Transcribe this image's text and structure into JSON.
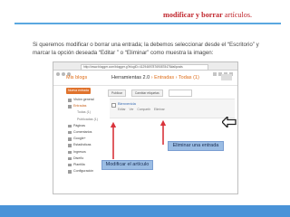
{
  "slide": {
    "title_bold": "modificar y borrar",
    "title_rest": "artículos.",
    "intro": "Si queremos modificar o borrar una entrada; la debemos seleccionar desde el “Escritorio” y marcar la opción deseada “Editar ” o “Eliminar” como muestra la imagen:",
    "colors": {
      "accent_rule": "#5aa8e0",
      "title": "#c0262d",
      "bottom_bar": "#4a93d8",
      "arrow": "#d9333b"
    }
  },
  "browser": {
    "url": "http://www.blogger.com/blogger.g?blogID=4129469787690878478#allposts"
  },
  "blogger": {
    "brand": "Mis blogs",
    "tools_label": "Herramientas 2.0",
    "crumb": "› Entradas › Todas (1)",
    "new_post_label": "Nueva entrada",
    "sidebar": [
      {
        "label": "Visión general",
        "icon": "overview-icon"
      },
      {
        "label": "Entradas",
        "icon": "posts-icon",
        "active": true
      },
      {
        "label": "Todas (1)",
        "sub": true
      },
      {
        "label": "Publicadas (1)",
        "sub": true
      },
      {
        "label": "Páginas",
        "icon": "pages-icon"
      },
      {
        "label": "Comentarios",
        "icon": "comments-icon"
      },
      {
        "label": "Google+",
        "icon": "google-plus-icon"
      },
      {
        "label": "Estadísticas",
        "icon": "stats-icon"
      },
      {
        "label": "Ingresos",
        "icon": "earnings-icon"
      },
      {
        "label": "Diseño",
        "icon": "layout-icon"
      },
      {
        "label": "Plantilla",
        "icon": "template-icon"
      },
      {
        "label": "Configuración",
        "icon": "settings-icon"
      }
    ],
    "toolbar": {
      "publish": "Publicar",
      "labels": "Cambiar etiquetas",
      "search": ""
    },
    "post": {
      "title": "Bienvenida",
      "actions": [
        "Editar",
        "Ver",
        "Compartir",
        "Eliminar"
      ]
    }
  },
  "callouts": {
    "delete_label": "Eliminar una entrada",
    "edit_label": "Modificar el artículo"
  }
}
